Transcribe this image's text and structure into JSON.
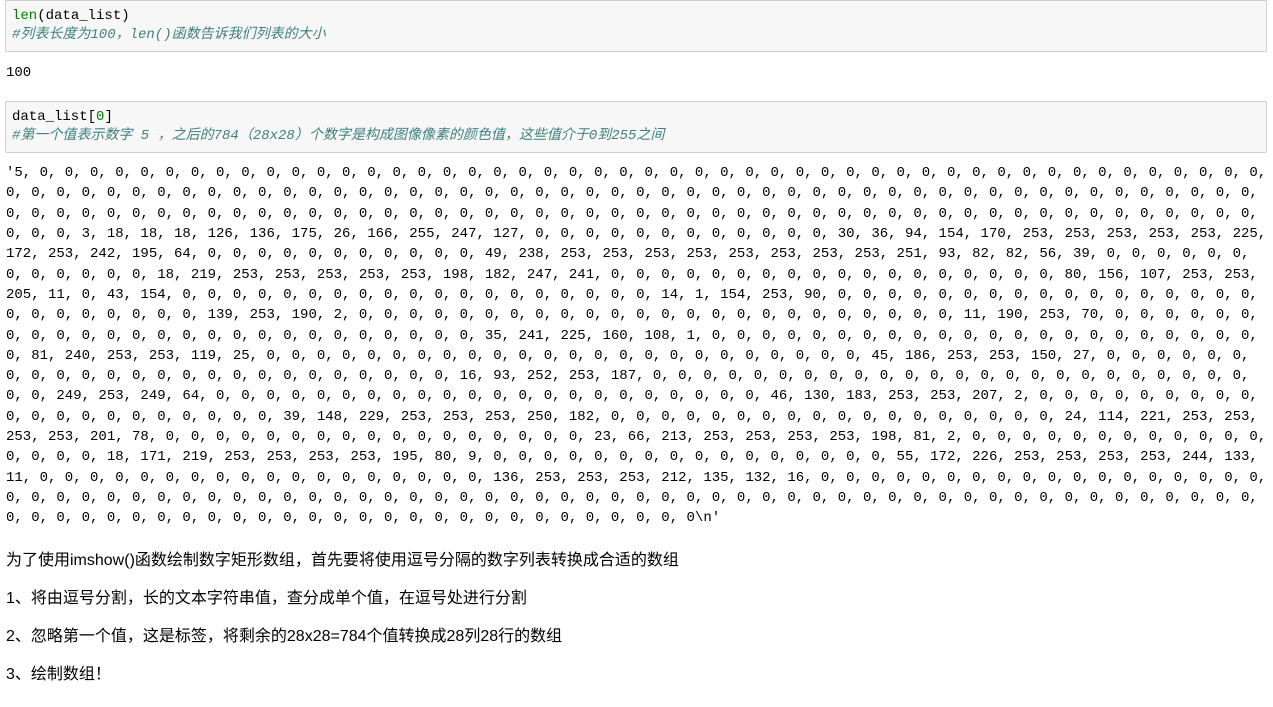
{
  "cell1": {
    "fn": "len",
    "lparen": "(",
    "arg": "data_list",
    "rparen": ")",
    "comment": "#列表长度为100，len()函数告诉我们列表的大小"
  },
  "out1": "100",
  "cell2": {
    "ident": "data_list",
    "lbrack": "[",
    "idx": "0",
    "rbrack": "]",
    "comment": "#第一个值表示数字 5 ，之后的784（28x28）个数字是构成图像像素的颜色值，这些值介于0到255之间"
  },
  "out2": "'5, 0, 0, 0, 0, 0, 0, 0, 0, 0, 0, 0, 0, 0, 0, 0, 0, 0, 0, 0, 0, 0, 0, 0, 0, 0, 0, 0, 0, 0, 0, 0, 0, 0, 0, 0, 0, 0, 0, 0, 0, 0, 0, 0, 0, 0, 0, 0, 0, 0, 0, 0, 0, 0, 0, 0, 0, 0, 0, 0, 0, 0, 0, 0, 0, 0, 0, 0, 0, 0, 0, 0, 0, 0, 0, 0, 0, 0, 0, 0, 0, 0, 0, 0, 0, 0, 0, 0, 0, 0, 0, 0, 0, 0, 0, 0, 0, 0, 0, 0, 0, 0, 0, 0, 0, 0, 0, 0, 0, 0, 0, 0, 0, 0, 0, 0, 0, 0, 0, 0, 0, 0, 0, 0, 0, 0, 0, 0, 0, 0, 0, 0, 0, 0, 0, 0, 0, 0, 0, 0, 0, 0, 0, 0, 0, 0, 0, 0, 0, 0, 0, 0, 0, 3, 18, 18, 18, 126, 136, 175, 26, 166, 255, 247, 127, 0, 0, 0, 0, 0, 0, 0, 0, 0, 0, 0, 0, 30, 36, 94, 154, 170, 253, 253, 253, 253, 253, 225, 172, 253, 242, 195, 64, 0, 0, 0, 0, 0, 0, 0, 0, 0, 0, 0, 49, 238, 253, 253, 253, 253, 253, 253, 253, 253, 251, 93, 82, 82, 56, 39, 0, 0, 0, 0, 0, 0, 0, 0, 0, 0, 0, 0, 18, 219, 253, 253, 253, 253, 253, 198, 182, 247, 241, 0, 0, 0, 0, 0, 0, 0, 0, 0, 0, 0, 0, 0, 0, 0, 0, 0, 0, 80, 156, 107, 253, 253, 205, 11, 0, 43, 154, 0, 0, 0, 0, 0, 0, 0, 0, 0, 0, 0, 0, 0, 0, 0, 0, 0, 0, 0, 14, 1, 154, 253, 90, 0, 0, 0, 0, 0, 0, 0, 0, 0, 0, 0, 0, 0, 0, 0, 0, 0, 0, 0, 0, 0, 0, 0, 0, 0, 139, 253, 190, 2, 0, 0, 0, 0, 0, 0, 0, 0, 0, 0, 0, 0, 0, 0, 0, 0, 0, 0, 0, 0, 0, 0, 0, 0, 11, 190, 253, 70, 0, 0, 0, 0, 0, 0, 0, 0, 0, 0, 0, 0, 0, 0, 0, 0, 0, 0, 0, 0, 0, 0, 0, 0, 0, 35, 241, 225, 160, 108, 1, 0, 0, 0, 0, 0, 0, 0, 0, 0, 0, 0, 0, 0, 0, 0, 0, 0, 0, 0, 0, 0, 0, 0, 81, 240, 253, 253, 119, 25, 0, 0, 0, 0, 0, 0, 0, 0, 0, 0, 0, 0, 0, 0, 0, 0, 0, 0, 0, 0, 0, 0, 0, 0, 45, 186, 253, 253, 150, 27, 0, 0, 0, 0, 0, 0, 0, 0, 0, 0, 0, 0, 0, 0, 0, 0, 0, 0, 0, 0, 0, 0, 0, 0, 16, 93, 252, 253, 187, 0, 0, 0, 0, 0, 0, 0, 0, 0, 0, 0, 0, 0, 0, 0, 0, 0, 0, 0, 0, 0, 0, 0, 0, 0, 0, 249, 253, 249, 64, 0, 0, 0, 0, 0, 0, 0, 0, 0, 0, 0, 0, 0, 0, 0, 0, 0, 0, 0, 0, 0, 0, 46, 130, 183, 253, 253, 207, 2, 0, 0, 0, 0, 0, 0, 0, 0, 0, 0, 0, 0, 0, 0, 0, 0, 0, 0, 0, 0, 39, 148, 229, 253, 253, 253, 250, 182, 0, 0, 0, 0, 0, 0, 0, 0, 0, 0, 0, 0, 0, 0, 0, 0, 0, 0, 24, 114, 221, 253, 253, 253, 253, 201, 78, 0, 0, 0, 0, 0, 0, 0, 0, 0, 0, 0, 0, 0, 0, 0, 0, 0, 23, 66, 213, 253, 253, 253, 253, 198, 81, 2, 0, 0, 0, 0, 0, 0, 0, 0, 0, 0, 0, 0, 0, 0, 0, 0, 18, 171, 219, 253, 253, 253, 253, 195, 80, 9, 0, 0, 0, 0, 0, 0, 0, 0, 0, 0, 0, 0, 0, 0, 0, 0, 55, 172, 226, 253, 253, 253, 253, 244, 133, 11, 0, 0, 0, 0, 0, 0, 0, 0, 0, 0, 0, 0, 0, 0, 0, 0, 0, 0, 136, 253, 253, 253, 212, 135, 132, 16, 0, 0, 0, 0, 0, 0, 0, 0, 0, 0, 0, 0, 0, 0, 0, 0, 0, 0, 0, 0, 0, 0, 0, 0, 0, 0, 0, 0, 0, 0, 0, 0, 0, 0, 0, 0, 0, 0, 0, 0, 0, 0, 0, 0, 0, 0, 0, 0, 0, 0, 0, 0, 0, 0, 0, 0, 0, 0, 0, 0, 0, 0, 0, 0, 0, 0, 0, 0, 0, 0, 0, 0, 0, 0, 0, 0, 0, 0, 0, 0, 0, 0, 0, 0, 0, 0, 0, 0, 0, 0, 0, 0, 0, 0, 0, 0\\n'",
  "md": {
    "p1": "为了使用imshow()函数绘制数字矩形数组，首先要将使用逗号分隔的数字列表转换成合适的数组",
    "p2": "1、将由逗号分割，长的文本字符串值，查分成单个值，在逗号处进行分割",
    "p3": "2、忽略第一个值，这是标签，将剩余的28x28=784个值转换成28列28行的数组",
    "p4": "3、绘制数组！"
  }
}
